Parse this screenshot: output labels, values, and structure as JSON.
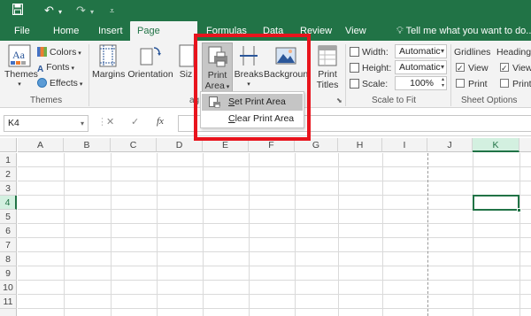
{
  "tabs": [
    {
      "label": "File"
    },
    {
      "label": "Home"
    },
    {
      "label": "Insert"
    },
    {
      "label": "Page Layout"
    },
    {
      "label": "Formulas"
    },
    {
      "label": "Data"
    },
    {
      "label": "Review"
    },
    {
      "label": "View"
    }
  ],
  "tell_me": "Tell me what you want to do...",
  "ribbon": {
    "themes": {
      "themes_label": "Themes",
      "colors_label": "Colors",
      "fonts_label": "Fonts",
      "effects_label": "Effects",
      "group_label": "Themes"
    },
    "page_setup": {
      "margins_label": "Margins",
      "orientation_label": "Orientation",
      "size_label": "Siz",
      "print_area_line1": "Print",
      "print_area_line2": "Area",
      "breaks_label": "Breaks",
      "background_label": "Background",
      "print_titles_line1": "Print",
      "print_titles_line2": "Titles",
      "group_label_fragment": "ag"
    },
    "scale_to_fit": {
      "width_label": "Width:",
      "width_value": "Automatic",
      "height_label": "Height:",
      "height_value": "Automatic",
      "scale_label": "Scale:",
      "scale_value": "100%",
      "group_label": "Scale to Fit"
    },
    "sheet_options": {
      "gridlines_label": "Gridlines",
      "headings_label": "Headings",
      "view_label": "View",
      "print_label": "Print",
      "gridlines_view_checked": true,
      "gridlines_print_checked": false,
      "headings_view_checked": true,
      "headings_print_checked": false,
      "group_label": "Sheet Options"
    }
  },
  "print_area_menu": {
    "set_prefix": "S",
    "set_rest": "et Print Area",
    "clear_prefix": "C",
    "clear_rest": "lear Print Area"
  },
  "formula_bar": {
    "name_box": "K4",
    "cancel_icon": "✕",
    "enter_icon": "✓",
    "fx_label": "fx",
    "formula_value": ""
  },
  "grid": {
    "columns": [
      "A",
      "B",
      "C",
      "D",
      "E",
      "F",
      "G",
      "H",
      "I",
      "J",
      "K"
    ],
    "rows": [
      "1",
      "2",
      "3",
      "4",
      "5",
      "6",
      "7",
      "8",
      "9",
      "10",
      "11"
    ],
    "selected_column": "K",
    "selected_row": "4"
  },
  "colors": {
    "excel_green": "#217346",
    "highlight_red": "#e8141d",
    "ribbon_bg": "#f3f3f3"
  },
  "icons": {
    "save": "save-icon",
    "undo": "undo-icon",
    "redo": "redo-icon",
    "customize": "customize-qat-icon",
    "lightbulb": "lightbulb-icon"
  }
}
